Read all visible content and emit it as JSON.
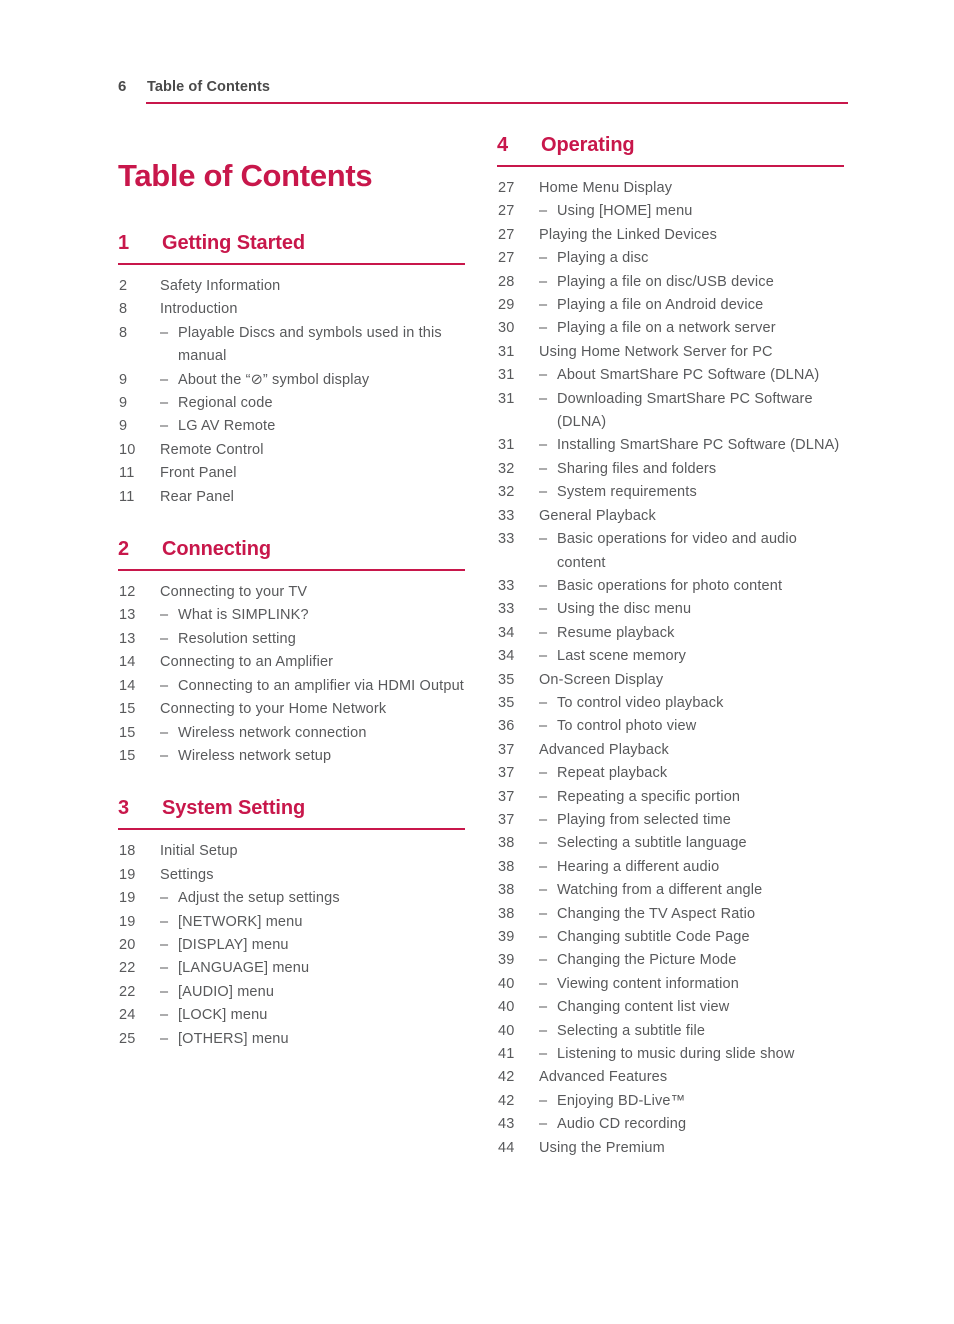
{
  "header": {
    "page_number": "6",
    "title": "Table of Contents",
    "accent_color": "#C8174B",
    "text_color": "#58595b"
  },
  "doc_title": "Table of Contents",
  "columns": {
    "left": [
      {
        "number": "1",
        "name": "Getting Started",
        "entries": [
          {
            "page": "2",
            "sub": false,
            "label": "Safety Information"
          },
          {
            "page": "8",
            "sub": false,
            "label": "Introduction"
          },
          {
            "page": "8",
            "sub": true,
            "label": "Playable Discs and symbols used in this manual"
          },
          {
            "page": "9",
            "sub": true,
            "label": "About the “⊘” symbol display"
          },
          {
            "page": "9",
            "sub": true,
            "label": "Regional code"
          },
          {
            "page": "9",
            "sub": true,
            "label": "LG AV Remote"
          },
          {
            "page": "10",
            "sub": false,
            "label": "Remote Control"
          },
          {
            "page": "11",
            "sub": false,
            "label": "Front Panel"
          },
          {
            "page": "11",
            "sub": false,
            "label": "Rear Panel"
          }
        ]
      },
      {
        "number": "2",
        "name": "Connecting",
        "entries": [
          {
            "page": "12",
            "sub": false,
            "label": "Connecting to your TV"
          },
          {
            "page": "13",
            "sub": true,
            "label": "What is SIMPLINK?"
          },
          {
            "page": "13",
            "sub": true,
            "label": "Resolution setting"
          },
          {
            "page": "14",
            "sub": false,
            "label": "Connecting to an Amplifier"
          },
          {
            "page": "14",
            "sub": true,
            "label": "Connecting to an amplifier via HDMI Output"
          },
          {
            "page": "15",
            "sub": false,
            "label": "Connecting to your Home Network"
          },
          {
            "page": "15",
            "sub": true,
            "label": "Wireless network connection"
          },
          {
            "page": "15",
            "sub": true,
            "label": "Wireless network setup"
          }
        ]
      },
      {
        "number": "3",
        "name": "System Setting",
        "entries": [
          {
            "page": "18",
            "sub": false,
            "label": "Initial Setup"
          },
          {
            "page": "19",
            "sub": false,
            "label": "Settings"
          },
          {
            "page": "19",
            "sub": true,
            "label": "Adjust the setup settings"
          },
          {
            "page": "19",
            "sub": true,
            "label": "[NETWORK] menu"
          },
          {
            "page": "20",
            "sub": true,
            "label": "[DISPLAY] menu"
          },
          {
            "page": "22",
            "sub": true,
            "label": "[LANGUAGE] menu"
          },
          {
            "page": "22",
            "sub": true,
            "label": "[AUDIO] menu"
          },
          {
            "page": "24",
            "sub": true,
            "label": "[LOCK] menu"
          },
          {
            "page": "25",
            "sub": true,
            "label": "[OTHERS] menu"
          }
        ]
      }
    ],
    "right": [
      {
        "number": "4",
        "name": "Operating",
        "entries": [
          {
            "page": "27",
            "sub": false,
            "label": "Home Menu Display"
          },
          {
            "page": "27",
            "sub": true,
            "label": "Using [HOME] menu"
          },
          {
            "page": "27",
            "sub": false,
            "label": "Playing the Linked Devices"
          },
          {
            "page": "27",
            "sub": true,
            "label": "Playing a disc"
          },
          {
            "page": "28",
            "sub": true,
            "label": "Playing a file on disc/USB device"
          },
          {
            "page": "29",
            "sub": true,
            "label": "Playing a file on Android device"
          },
          {
            "page": "30",
            "sub": true,
            "label": "Playing a file on a network server"
          },
          {
            "page": "31",
            "sub": false,
            "label": "Using Home Network Server for PC"
          },
          {
            "page": "31",
            "sub": true,
            "label": "About SmartShare PC Software (DLNA)"
          },
          {
            "page": "31",
            "sub": true,
            "label": "Downloading SmartShare PC Software (DLNA)"
          },
          {
            "page": "31",
            "sub": true,
            "label": "Installing SmartShare PC Software (DLNA)"
          },
          {
            "page": "32",
            "sub": true,
            "label": "Sharing files and folders"
          },
          {
            "page": "32",
            "sub": true,
            "label": "System requirements"
          },
          {
            "page": "33",
            "sub": false,
            "label": "General Playback"
          },
          {
            "page": "33",
            "sub": true,
            "label": "Basic operations for video and audio content"
          },
          {
            "page": "33",
            "sub": true,
            "label": "Basic operations for photo content"
          },
          {
            "page": "33",
            "sub": true,
            "label": "Using the disc menu"
          },
          {
            "page": "34",
            "sub": true,
            "label": "Resume playback"
          },
          {
            "page": "34",
            "sub": true,
            "label": "Last scene memory"
          },
          {
            "page": "35",
            "sub": false,
            "label": "On-Screen Display"
          },
          {
            "page": "35",
            "sub": true,
            "label": "To control video playback"
          },
          {
            "page": "36",
            "sub": true,
            "label": "To control photo view"
          },
          {
            "page": "37",
            "sub": false,
            "label": "Advanced Playback"
          },
          {
            "page": "37",
            "sub": true,
            "label": "Repeat playback"
          },
          {
            "page": "37",
            "sub": true,
            "label": "Repeating a specific portion"
          },
          {
            "page": "37",
            "sub": true,
            "label": "Playing from selected time"
          },
          {
            "page": "38",
            "sub": true,
            "label": "Selecting a subtitle language"
          },
          {
            "page": "38",
            "sub": true,
            "label": "Hearing a different audio"
          },
          {
            "page": "38",
            "sub": true,
            "label": "Watching from a different angle"
          },
          {
            "page": "38",
            "sub": true,
            "label": "Changing the TV Aspect Ratio"
          },
          {
            "page": "39",
            "sub": true,
            "label": "Changing subtitle Code Page"
          },
          {
            "page": "39",
            "sub": true,
            "label": "Changing the Picture Mode"
          },
          {
            "page": "40",
            "sub": true,
            "label": "Viewing content information"
          },
          {
            "page": "40",
            "sub": true,
            "label": "Changing content list view"
          },
          {
            "page": "40",
            "sub": true,
            "label": "Selecting a subtitle file"
          },
          {
            "page": "41",
            "sub": true,
            "label": "Listening to music during slide show"
          },
          {
            "page": "42",
            "sub": false,
            "label": "Advanced Features"
          },
          {
            "page": "42",
            "sub": true,
            "label": "Enjoying BD-Live™"
          },
          {
            "page": "43",
            "sub": true,
            "label": "Audio CD recording"
          },
          {
            "page": "44",
            "sub": false,
            "label": "Using the Premium"
          }
        ]
      }
    ]
  },
  "symbols": {
    "sub_dash": "–"
  }
}
